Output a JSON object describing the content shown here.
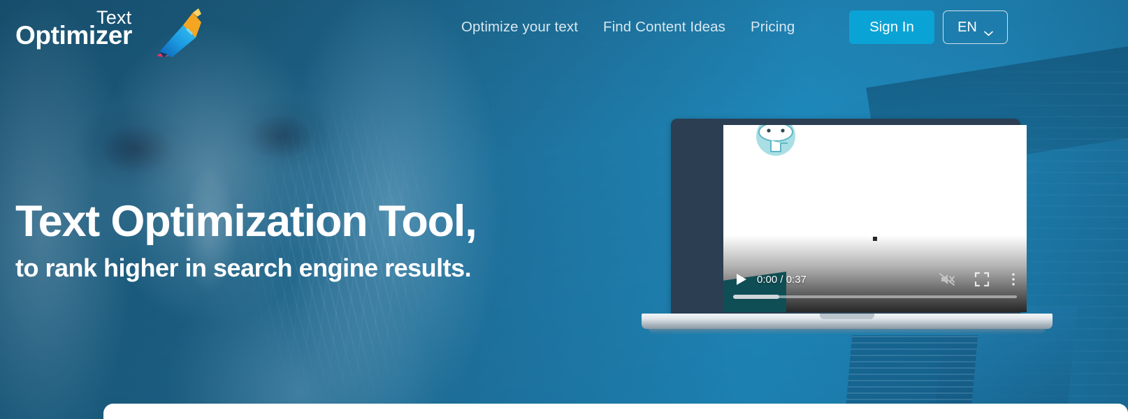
{
  "brand": {
    "logo_line1": "Text",
    "logo_line2": "Optimizer",
    "logo_icon": "pencil-rocket-icon",
    "accent_color": "#0aa3d6",
    "header_bg_color": "#1d5d7e"
  },
  "nav": {
    "links": [
      {
        "label": "Optimize your text"
      },
      {
        "label": "Find Content Ideas"
      },
      {
        "label": "Pricing"
      }
    ],
    "signin_label": "Sign In",
    "language_label": "EN",
    "language_chevron_icon": "chevron-down-icon"
  },
  "hero": {
    "title": "Text Optimization Tool,",
    "subtitle": "to rank higher in search engine results."
  },
  "video": {
    "play_icon": "play-icon",
    "time_display": "0:00 / 0:37",
    "current_time": "0:00",
    "duration": "0:37",
    "mute_icon": "volume-muted-icon",
    "fullscreen_icon": "fullscreen-icon",
    "menu_icon": "more-vertical-icon",
    "progress_percent": 0,
    "mascot_icon": "mascot-avatar-icon"
  }
}
